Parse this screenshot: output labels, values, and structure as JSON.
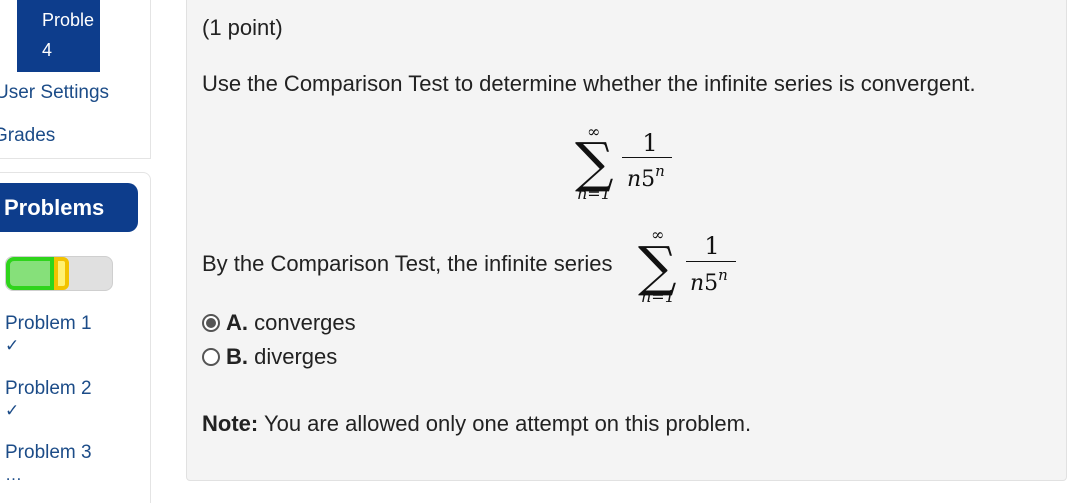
{
  "sidebar": {
    "current_problem_label": "Proble",
    "current_problem_number": "4",
    "links": {
      "user_settings": "User Settings",
      "grades": "Grades"
    },
    "problems_header": "Problems",
    "progress": {
      "correct_fraction": 0.45,
      "partial_fraction": 0.14,
      "correct_color": "#2fd41c",
      "partial_color": "#f2c200"
    },
    "problems": [
      {
        "label": "Problem 1",
        "status": "✓"
      },
      {
        "label": "Problem 2",
        "status": "✓"
      },
      {
        "label": "Problem 3",
        "status": "…"
      }
    ]
  },
  "problem": {
    "points": "(1 point)",
    "question": "Use the Comparison Test to determine whether the infinite series is convergent.",
    "series": {
      "sum_symbol": "∑",
      "upper": "∞",
      "lower": "n=1",
      "numerator": "1",
      "den_base": "n",
      "den_five": "5",
      "den_exp": "n"
    },
    "sentence": "By the Comparison Test, the infinite series",
    "options": [
      {
        "letter": "A.",
        "text": "converges",
        "selected": true
      },
      {
        "letter": "B.",
        "text": "diverges",
        "selected": false
      }
    ],
    "note_label": "Note:",
    "note_text": "You are allowed only one attempt on this problem."
  },
  "colors": {
    "nav_blue": "#0d3d8c",
    "link_blue": "#1c4c88",
    "panel_bg": "#f4f4f4"
  }
}
